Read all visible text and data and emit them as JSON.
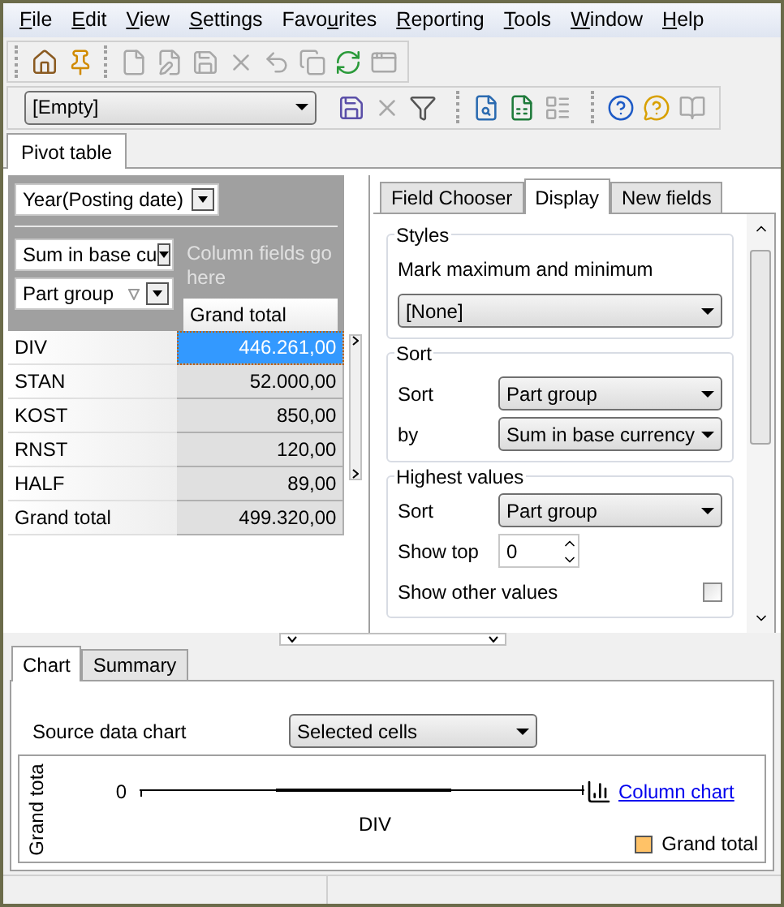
{
  "menu": [
    {
      "mnemonic": "F",
      "after": "ile"
    },
    {
      "mnemonic": "E",
      "after": "dit"
    },
    {
      "mnemonic": "V",
      "after": "iew"
    },
    {
      "mnemonic": "S",
      "after": "ettings"
    },
    {
      "before": "Favo",
      "mnemonic": "u",
      "after": "rites"
    },
    {
      "mnemonic": "R",
      "after": "eporting"
    },
    {
      "mnemonic": "T",
      "after": "ools"
    },
    {
      "mnemonic": "W",
      "after": "indow"
    },
    {
      "mnemonic": "H",
      "after": "elp"
    }
  ],
  "toolbar_1": [
    [
      {
        "kind": "home",
        "disabled": false
      },
      {
        "kind": "pin",
        "disabled": false
      }
    ],
    [
      {
        "kind": "new",
        "disabled": true
      },
      {
        "kind": "edit",
        "disabled": true
      },
      {
        "kind": "save",
        "disabled": true
      },
      {
        "kind": "delete",
        "disabled": true
      },
      {
        "kind": "undo",
        "disabled": true
      },
      {
        "kind": "copy",
        "disabled": true
      },
      {
        "kind": "refresh",
        "disabled": false
      },
      {
        "kind": "window",
        "disabled": true
      }
    ]
  ],
  "toolbar_2": {
    "layout_select": "[Empty]",
    "groups": [
      [
        {
          "kind": "save",
          "disabled": false
        },
        {
          "kind": "delete",
          "disabled": true
        },
        {
          "kind": "filter",
          "disabled": false
        }
      ],
      [
        {
          "kind": "preview",
          "disabled": false
        },
        {
          "kind": "excel",
          "disabled": false
        },
        {
          "kind": "layout",
          "disabled": true
        }
      ],
      [
        {
          "kind": "help",
          "disabled": false
        },
        {
          "kind": "hint",
          "disabled": false
        },
        {
          "kind": "book",
          "disabled": true
        }
      ]
    ]
  },
  "main_tabs": [
    {
      "label": "Pivot table",
      "selected": true
    }
  ],
  "pivot": {
    "filter_field": "Year(Posting date)",
    "data_field": "Sum in base cu",
    "column_placeholder": "Column fields go here",
    "row_field": "Part group",
    "column_header": "Grand total",
    "rows": [
      {
        "label": "DIV",
        "value": "446.261,00",
        "selected": true
      },
      {
        "label": "STAN",
        "value": "52.000,00",
        "selected": false
      },
      {
        "label": "KOST",
        "value": "850,00",
        "selected": false
      },
      {
        "label": "RNST",
        "value": "120,00",
        "selected": false
      },
      {
        "label": "HALF",
        "value": "89,00",
        "selected": false
      },
      {
        "label": "Grand total",
        "value": "499.320,00",
        "selected": false
      }
    ]
  },
  "side_tabs": [
    {
      "label": "Field Chooser",
      "selected": false
    },
    {
      "label": "Display",
      "selected": true
    },
    {
      "label": "New fields",
      "selected": false
    }
  ],
  "display": {
    "styles": {
      "title": "Styles",
      "label": "Mark maximum and minimum",
      "value": "[None]"
    },
    "sort": {
      "title": "Sort",
      "rows": [
        {
          "label": "Sort",
          "value": "Part group"
        },
        {
          "label": "by",
          "value": "Sum in base currency"
        }
      ]
    },
    "highest": {
      "title": "Highest values",
      "sort_label": "Sort",
      "sort_value": "Part group",
      "top_label": "Show top",
      "top_value": "0",
      "other_label": "Show other values",
      "other_checked": false
    }
  },
  "bottom_tabs": [
    {
      "label": "Chart",
      "selected": true
    },
    {
      "label": "Summary",
      "selected": false
    }
  ],
  "chart": {
    "source_label": "Source data chart",
    "source_value": "Selected cells",
    "ylabel": "Grand tota",
    "tick": "0",
    "category": "DIV",
    "type_link": "Column chart",
    "legend": {
      "label": "Grand total",
      "color": "#ffc267"
    }
  }
}
